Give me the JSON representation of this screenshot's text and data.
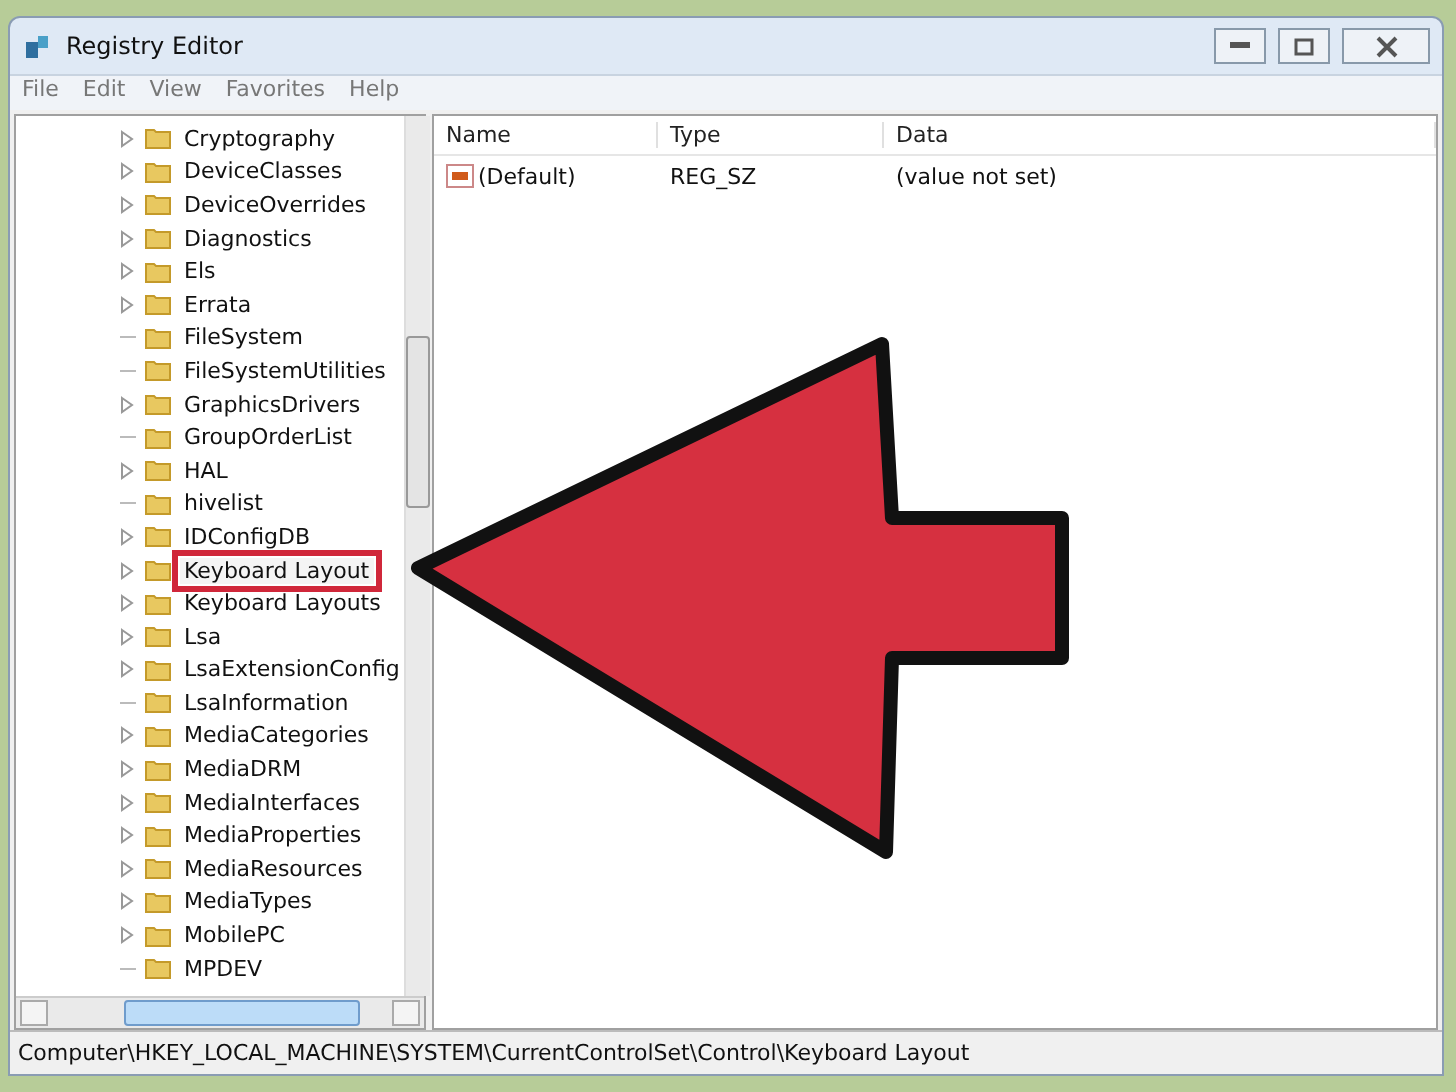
{
  "window": {
    "title": "Registry Editor"
  },
  "menu": [
    "File",
    "Edit",
    "View",
    "Favorites",
    "Help"
  ],
  "tree": [
    {
      "label": "Cryptography",
      "expandable": true,
      "highlighted": false
    },
    {
      "label": "DeviceClasses",
      "expandable": true,
      "highlighted": false
    },
    {
      "label": "DeviceOverrides",
      "expandable": true,
      "highlighted": false
    },
    {
      "label": "Diagnostics",
      "expandable": true,
      "highlighted": false
    },
    {
      "label": "Els",
      "expandable": true,
      "highlighted": false
    },
    {
      "label": "Errata",
      "expandable": true,
      "highlighted": false
    },
    {
      "label": "FileSystem",
      "expandable": false,
      "highlighted": false
    },
    {
      "label": "FileSystemUtilities",
      "expandable": false,
      "highlighted": false
    },
    {
      "label": "GraphicsDrivers",
      "expandable": true,
      "highlighted": false
    },
    {
      "label": "GroupOrderList",
      "expandable": false,
      "highlighted": false
    },
    {
      "label": "HAL",
      "expandable": true,
      "highlighted": false
    },
    {
      "label": "hivelist",
      "expandable": false,
      "highlighted": false
    },
    {
      "label": "IDConfigDB",
      "expandable": true,
      "highlighted": false
    },
    {
      "label": "Keyboard Layout",
      "expandable": true,
      "highlighted": true
    },
    {
      "label": "Keyboard Layouts",
      "expandable": true,
      "highlighted": false
    },
    {
      "label": "Lsa",
      "expandable": true,
      "highlighted": false
    },
    {
      "label": "LsaExtensionConfig",
      "expandable": true,
      "highlighted": false
    },
    {
      "label": "LsaInformation",
      "expandable": false,
      "highlighted": false
    },
    {
      "label": "MediaCategories",
      "expandable": true,
      "highlighted": false
    },
    {
      "label": "MediaDRM",
      "expandable": true,
      "highlighted": false
    },
    {
      "label": "MediaInterfaces",
      "expandable": true,
      "highlighted": false
    },
    {
      "label": "MediaProperties",
      "expandable": true,
      "highlighted": false
    },
    {
      "label": "MediaResources",
      "expandable": true,
      "highlighted": false
    },
    {
      "label": "MediaTypes",
      "expandable": true,
      "highlighted": false
    },
    {
      "label": "MobilePC",
      "expandable": true,
      "highlighted": false
    },
    {
      "label": "MPDEV",
      "expandable": false,
      "highlighted": false
    }
  ],
  "table": {
    "columns": [
      "Name",
      "Type",
      "Data"
    ],
    "rows": [
      [
        "(Default)",
        "REG_SZ",
        "(value not set)"
      ]
    ]
  },
  "status_bar": "Computer\\HKEY_LOCAL_MACHINE\\SYSTEM\\CurrentControlSet\\Control\\Keyboard Layout"
}
